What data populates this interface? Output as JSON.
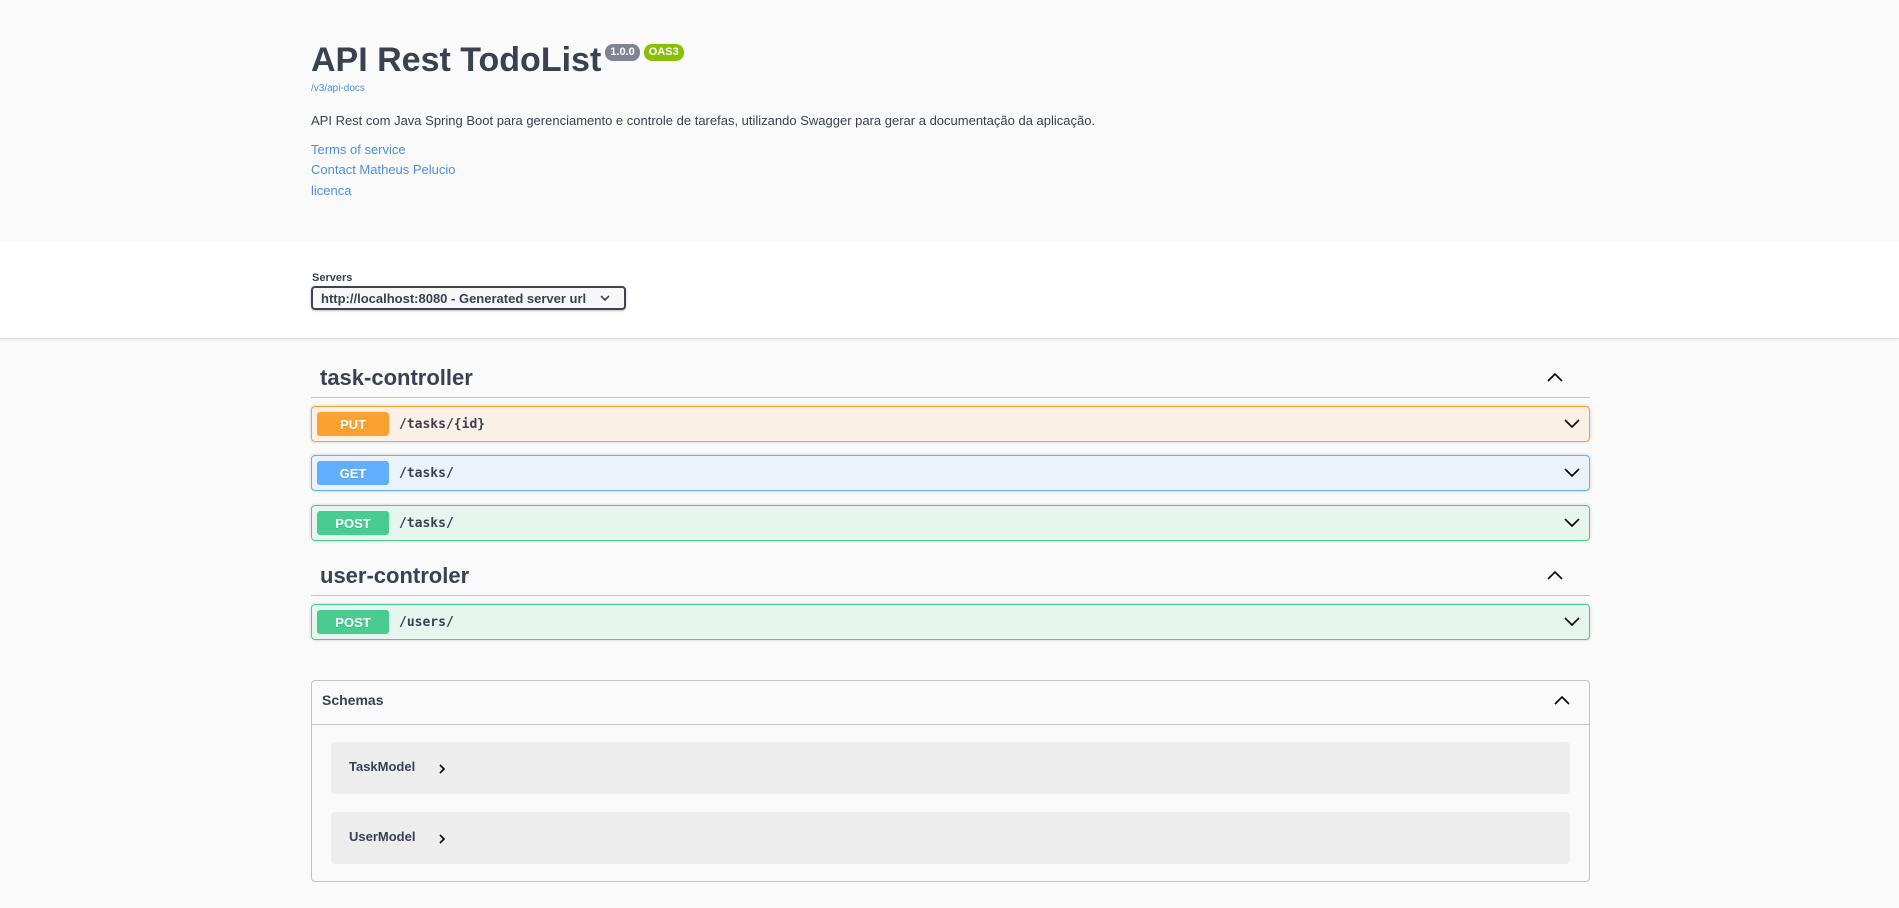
{
  "info": {
    "title": "API Rest TodoList",
    "version": "1.0.0",
    "oas_badge": "OAS3",
    "api_docs_link": "/v3/api-docs",
    "description": "API Rest com Java Spring Boot para gerenciamento e controle de tarefas, utilizando Swagger para gerar a documentação da aplicação.",
    "terms_link": "Terms of service",
    "contact_link": "Contact Matheus Pelucio",
    "license_link": "licenca"
  },
  "servers": {
    "label": "Servers",
    "selected": "http://localhost:8080 - Generated server url"
  },
  "tags": [
    {
      "name": "task-controller",
      "operations": [
        {
          "method": "PUT",
          "path": "/tasks/{id}"
        },
        {
          "method": "GET",
          "path": "/tasks/"
        },
        {
          "method": "POST",
          "path": "/tasks/"
        }
      ]
    },
    {
      "name": "user-controler",
      "operations": [
        {
          "method": "POST",
          "path": "/users/"
        }
      ]
    }
  ],
  "schemas": {
    "title": "Schemas",
    "models": [
      "TaskModel",
      "UserModel"
    ]
  },
  "colors": {
    "put": "#fca130",
    "get": "#61affe",
    "post": "#49cc90",
    "link": "#4990e2",
    "version_badge": "#7d8492",
    "oas_badge": "#89bf04"
  },
  "icons": {
    "expand": "chevron-down-icon",
    "collapse": "chevron-up-icon",
    "model_expand": "chevron-right-icon"
  }
}
